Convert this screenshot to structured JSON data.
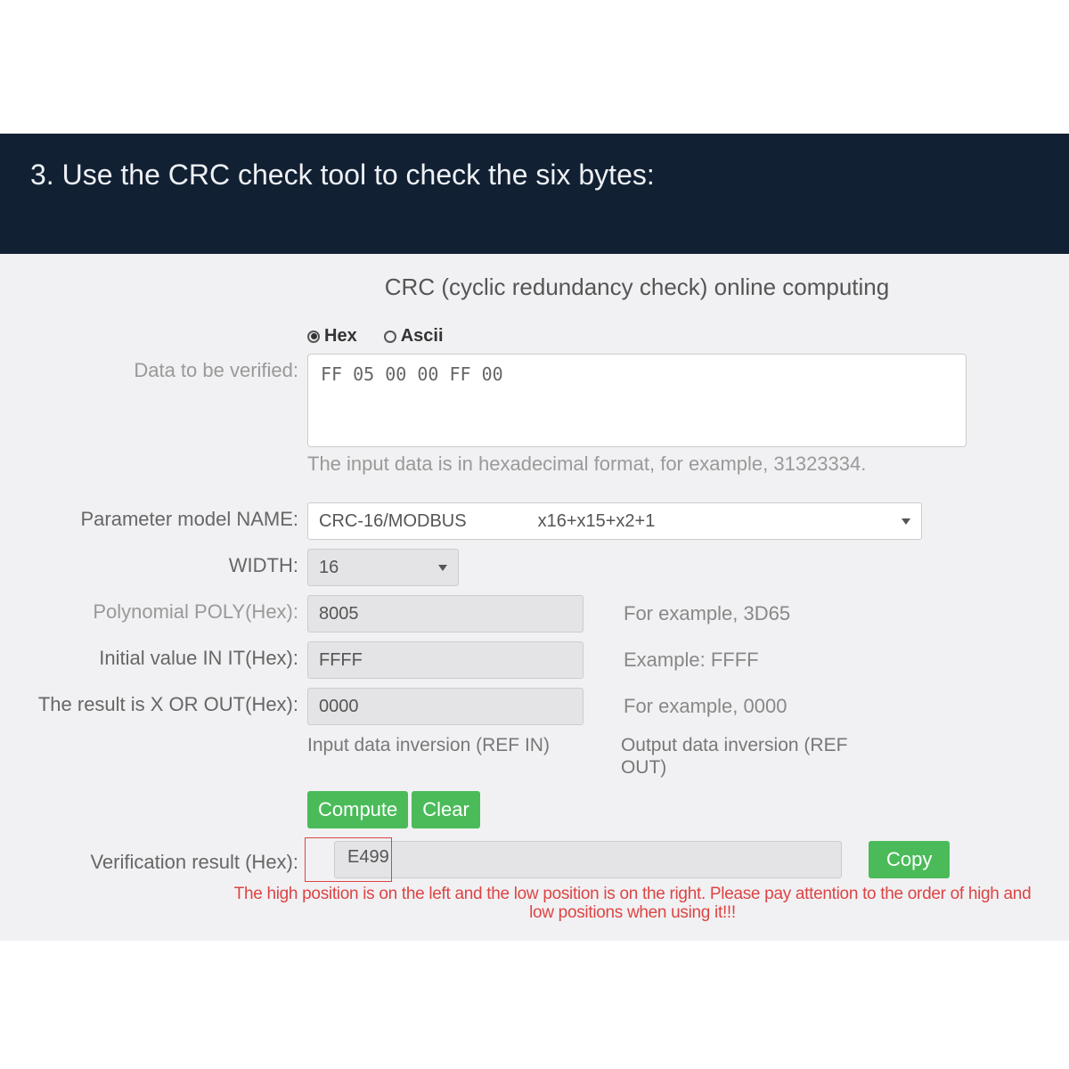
{
  "header": {
    "title": "3. Use the CRC check tool to check the six bytes:"
  },
  "panel": {
    "title": "CRC (cyclic redundancy check) online computing",
    "format": {
      "hex_label": "Hex",
      "ascii_label": "Ascii",
      "selected": "hex"
    },
    "data": {
      "label": "Data to be verified:",
      "value": "FF 05 00 00 FF 00",
      "hint": "The input data is in hexadecimal format, for example, 31323334."
    },
    "model": {
      "label": "Parameter model NAME:",
      "name": "CRC-16/MODBUS",
      "polynomial_text": "x16+x15+x2+1"
    },
    "width": {
      "label": "WIDTH:",
      "value": "16"
    },
    "poly": {
      "label": "Polynomial POLY(Hex):",
      "value": "8005",
      "example": "For example, 3D65"
    },
    "init": {
      "label": "Initial value IN IT(Hex):",
      "value": "FFFF",
      "example": "Example: FFFF"
    },
    "xorout": {
      "label": "The result is X OR OUT(Hex):",
      "value": "0000",
      "example": "For example, 0000"
    },
    "inversion": {
      "refin_label": "Input data inversion (REF IN)",
      "refout_label": "Output data inversion (REF OUT)"
    },
    "buttons": {
      "compute": "Compute",
      "clear": "Clear",
      "copy": "Copy"
    },
    "result": {
      "label": "Verification result (Hex):",
      "value": "E499"
    },
    "warning": "The high position is on the left and the low position is on the right. Please pay attention to the order of high and low positions when using it!!!"
  }
}
